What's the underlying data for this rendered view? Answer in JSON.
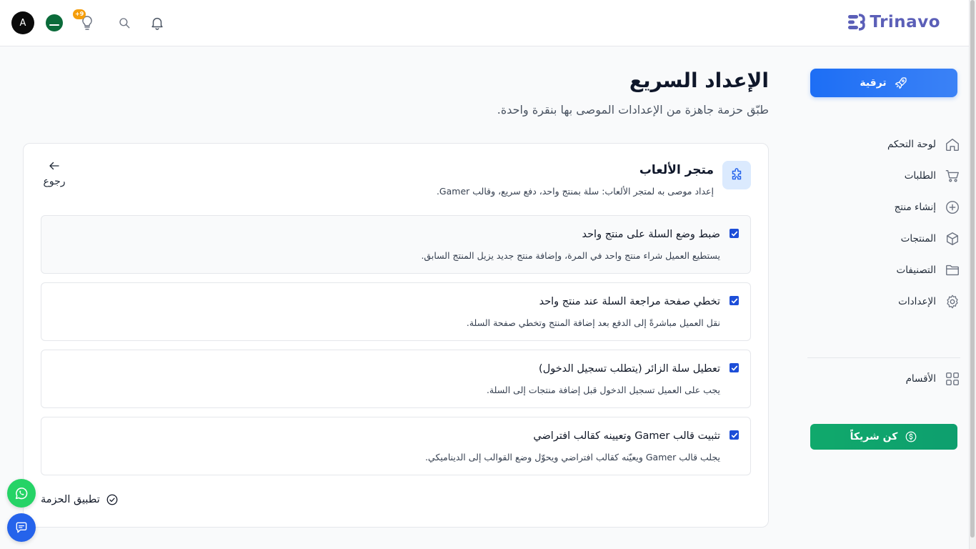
{
  "header": {
    "logo_text": "Trinavo",
    "avatar_letter": "A",
    "notifications_badge": "+9",
    "icons": [
      "bell-icon",
      "search-icon",
      "lightbulb-icon",
      "saudi-flag-icon"
    ]
  },
  "sidebar": {
    "upgrade_label": "ترقية",
    "items": [
      {
        "label": "لوحة التحكم",
        "icon": "home-icon"
      },
      {
        "label": "الطلبات",
        "icon": "cart-icon"
      },
      {
        "label": "إنشاء منتج",
        "icon": "plus-circle-icon"
      },
      {
        "label": "المنتجات",
        "icon": "box-icon"
      },
      {
        "label": "التصنيفات",
        "icon": "folder-icon"
      },
      {
        "label": "الإعدادات",
        "icon": "gear-icon"
      }
    ],
    "sections_label": "الأقسام",
    "partner_label": "كن شريكاً"
  },
  "page": {
    "title": "الإعداد السريع",
    "subtitle": "طبّق حزمة جاهزة من الإعدادات الموصى بها بنقرة واحدة."
  },
  "pack": {
    "title": "متجر الألعاب",
    "description": "إعداد موصى به لمتجر الألعاب: سلة بمنتج واحد، دفع سريع، وقالب Gamer.",
    "back_label": "رجوع",
    "options": [
      {
        "title": "ضبط وضع السلة على منتج واحد",
        "description": "يستطيع العميل شراء منتج واحد في المرة، وإضافة منتج جديد يزيل المنتج السابق.",
        "checked": true
      },
      {
        "title": "تخطي صفحة مراجعة السلة عند منتج واحد",
        "description": "نقل العميل مباشرةً إلى الدفع بعد إضافة المنتج وتخطي صفحة السلة.",
        "checked": true
      },
      {
        "title": "تعطيل سلة الزائر (يتطلب تسجيل الدخول)",
        "description": "يجب على العميل تسجيل الدخول قبل إضافة منتجات إلى السلة.",
        "checked": true
      },
      {
        "title": "تثبيت قالب Gamer وتعيينه كقالب افتراضي",
        "description": "يجلب قالب Gamer ويعيّنه كقالب افتراضي ويحوّل وضع القوالب إلى الديناميكي.",
        "checked": true
      }
    ],
    "apply_label": "تطبيق الحزمة"
  },
  "colors": {
    "accent": "#1d6ef5",
    "partner": "#10a96c",
    "checkbox": "#1d4ed8",
    "whatsapp": "#25d366"
  }
}
